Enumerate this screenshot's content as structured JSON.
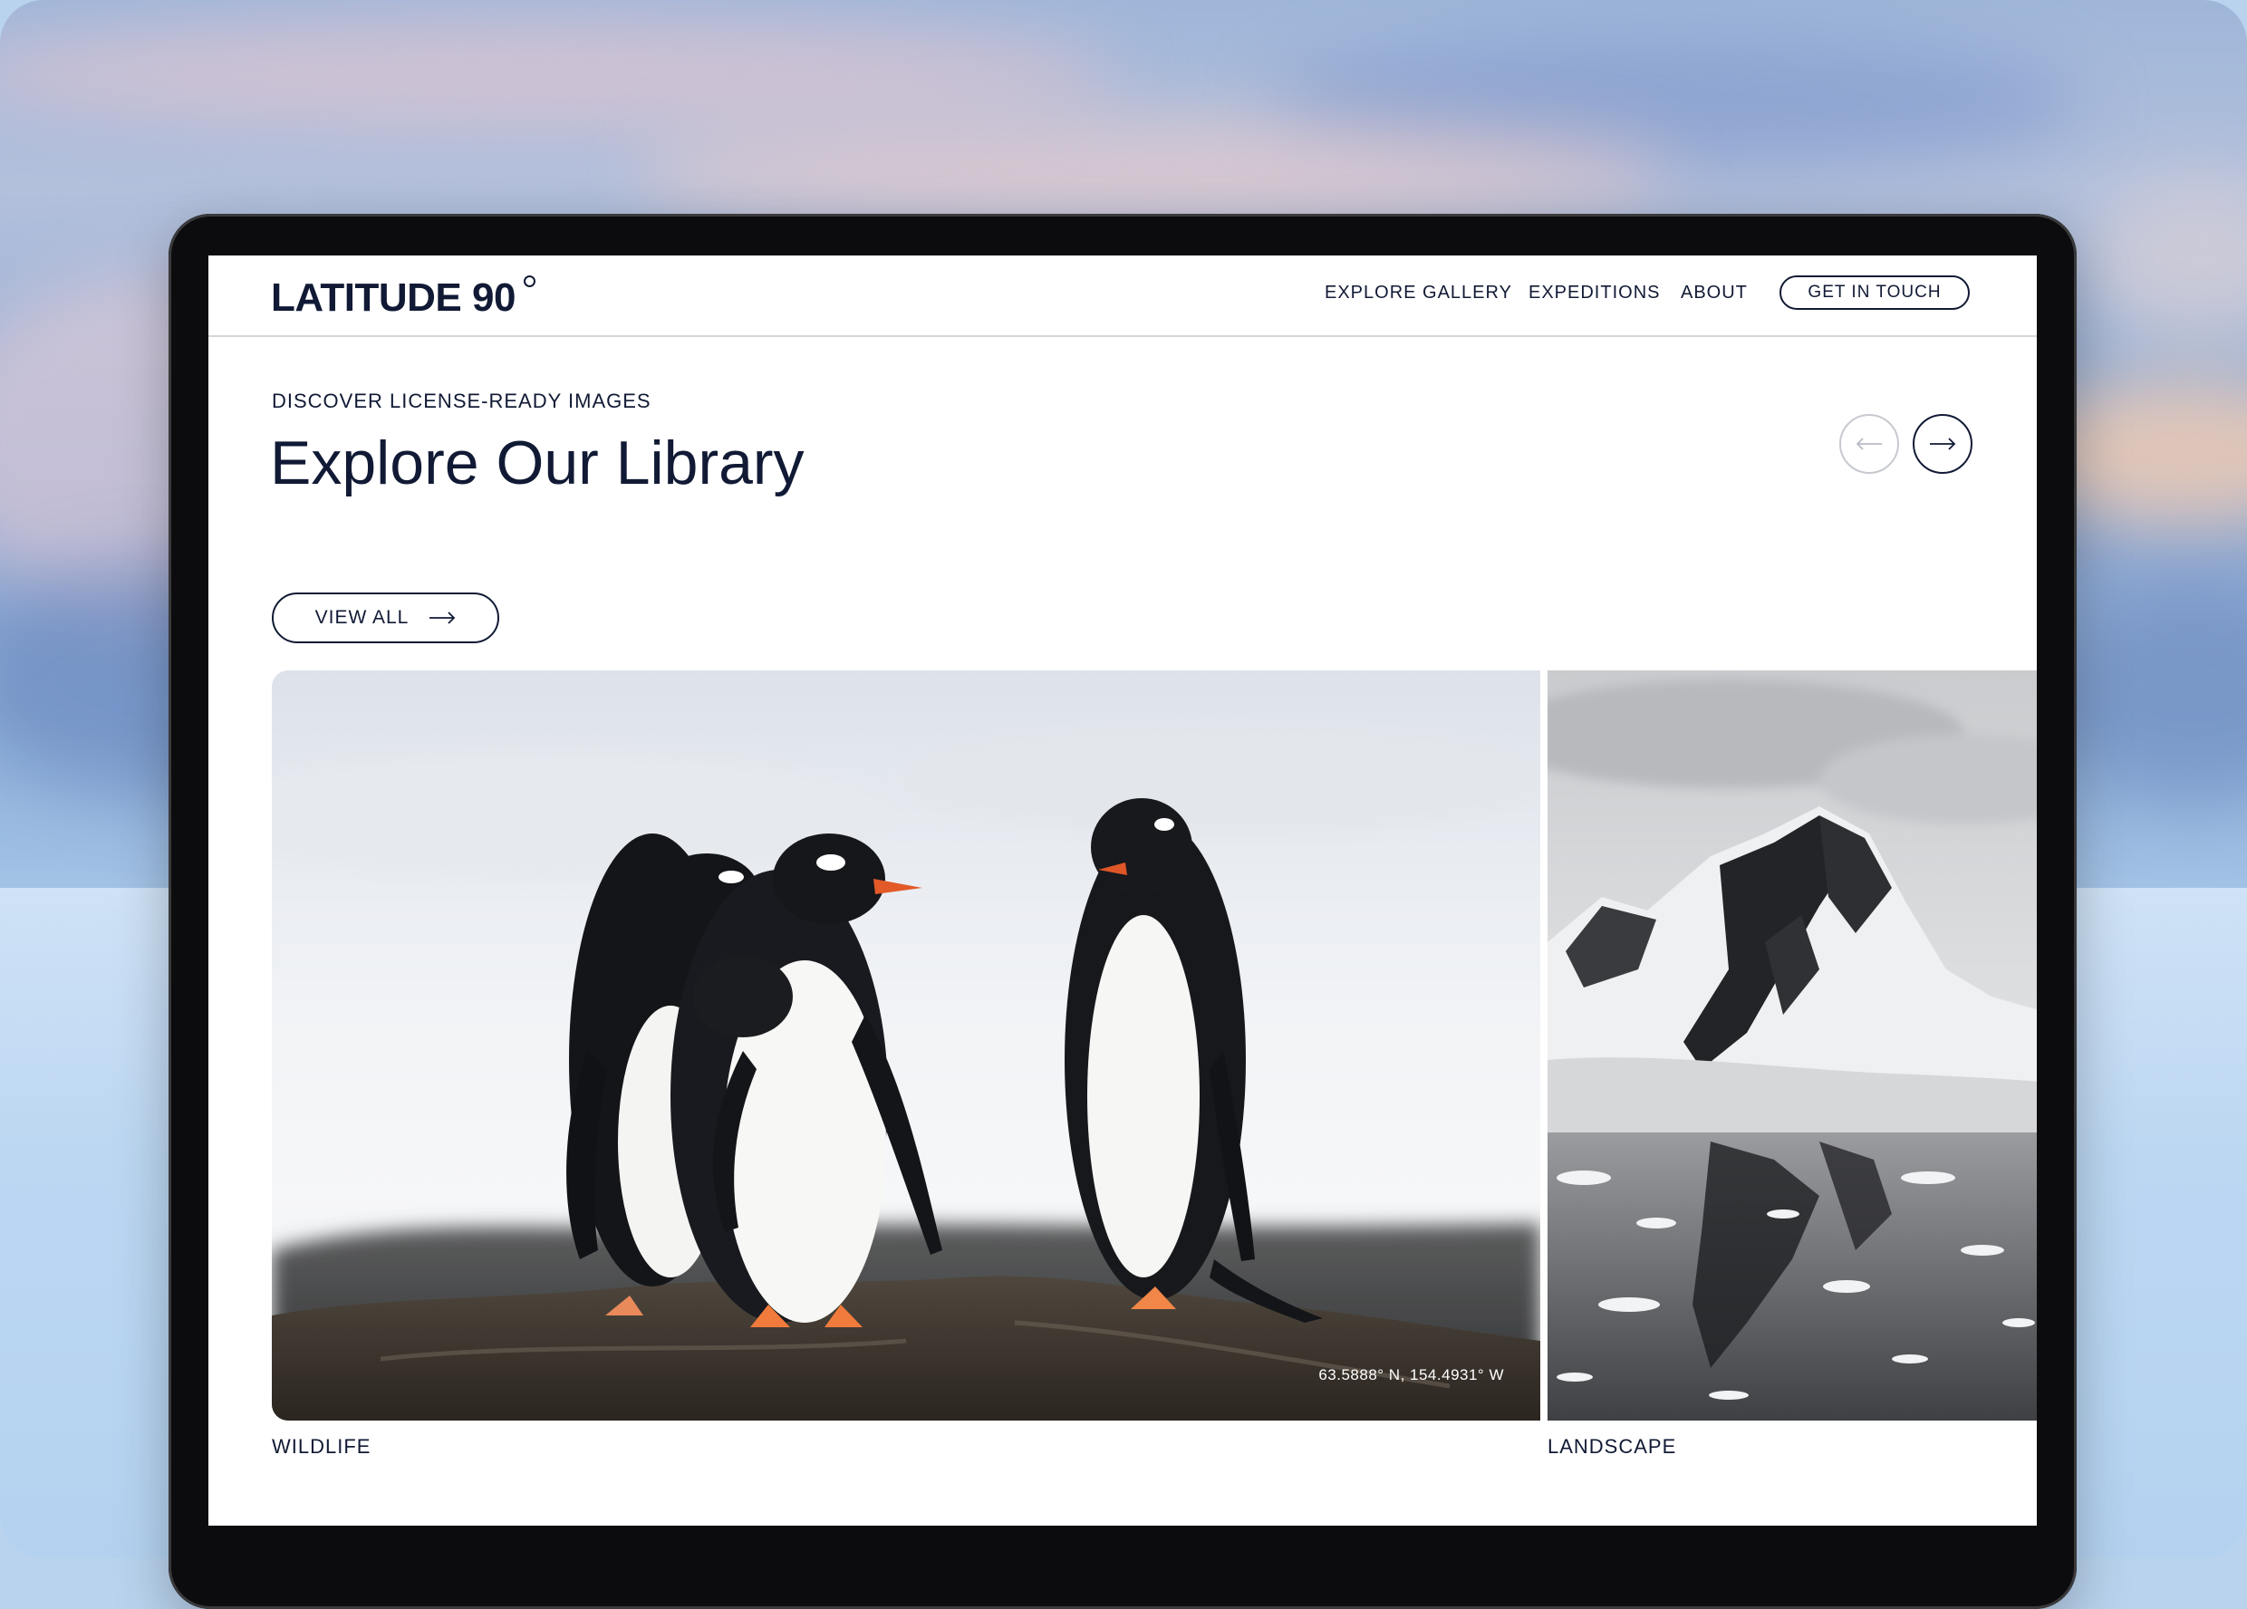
{
  "brand": {
    "logo_text": "LATITUDE 90"
  },
  "nav": {
    "items": [
      "EXPLORE GALLERY",
      "EXPEDITIONS",
      "ABOUT"
    ],
    "cta_label": "GET IN TOUCH"
  },
  "hero": {
    "eyebrow": "DISCOVER LICENSE-READY IMAGES",
    "title": "Explore Our Library",
    "view_all_label": "VIEW ALL"
  },
  "carousel": {
    "prev_icon": "arrow-left-icon",
    "next_icon": "arrow-right-icon"
  },
  "gallery": {
    "items": [
      {
        "category": "WILDLIFE",
        "coords": "63.5888° N, 154.4931° W"
      },
      {
        "category": "LANDSCAPE"
      }
    ]
  },
  "colors": {
    "ink": "#111a35",
    "page": "#ffffff",
    "divider": "#d4d6da"
  }
}
